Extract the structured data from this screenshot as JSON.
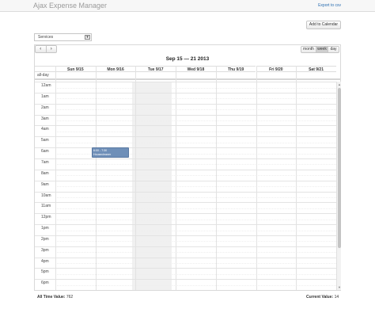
{
  "app": {
    "title": "Ajax Expense Manager",
    "export_link": "Export to csv"
  },
  "toolbar": {
    "add_label": "Add to Calendar",
    "filter_value": "Services"
  },
  "calendar": {
    "title": "Sep 15 — 21 2013",
    "prev_icon": "‹",
    "next_icon": "›",
    "views": {
      "month": "month",
      "week": "week",
      "day": "day"
    },
    "active_view": "week",
    "days": [
      "Sun 9/15",
      "Mon 9/16",
      "Tue 9/17",
      "Wed 9/18",
      "Thu 9/19",
      "Fri 9/20",
      "Sat 9/21"
    ],
    "today": "Tue 9/17",
    "allday_label": "all-day",
    "hours": [
      "12am",
      "1am",
      "2am",
      "3am",
      "4am",
      "5am",
      "6am",
      "7am",
      "8am",
      "9am",
      "10am",
      "11am",
      "12pm",
      "1pm",
      "2pm",
      "3pm",
      "4pm",
      "5pm",
      "6pm"
    ],
    "event": {
      "time": "6:00 - 7:30",
      "title": "Housecleaner",
      "color": "#6f8fb8"
    }
  },
  "footer": {
    "all_time_label": "All Time Value:",
    "all_time_value": "762",
    "current_label": "Current Value:",
    "current_value": "14"
  }
}
